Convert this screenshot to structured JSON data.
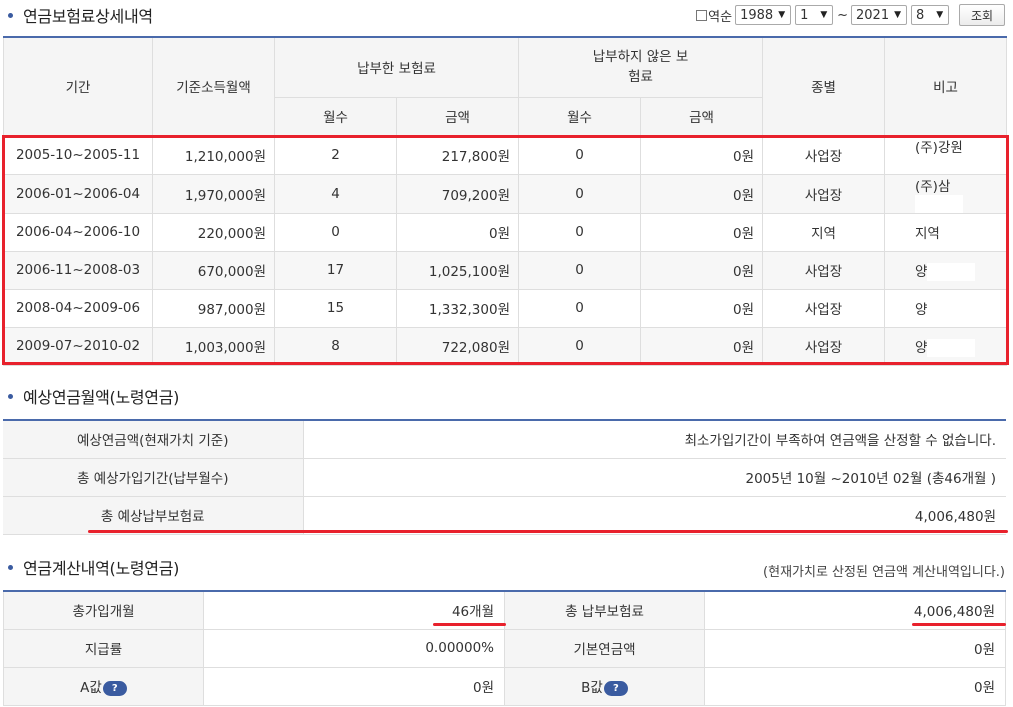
{
  "section1": {
    "title": "연금보험료상세내역",
    "filter": {
      "reverse_label": "역순",
      "start_year": "1988",
      "start_month": "1",
      "tilde": "~",
      "end_year": "2021",
      "end_month": "8",
      "search_label": "조회"
    },
    "headers": {
      "period": "기간",
      "base_income": "기준소득월액",
      "paid": "납부한 보험료",
      "unpaid": "납부하지 않은 보험료",
      "months": "월수",
      "amount": "금액",
      "type": "종별",
      "note": "비고"
    },
    "rows": [
      {
        "period": "2005-10~2005-11",
        "income": "1,210,000원",
        "paid_months": "2",
        "paid_amount": "217,800원",
        "unpaid_months": "0",
        "unpaid_amount": "0원",
        "type": "사업장",
        "note": "(주)강원"
      },
      {
        "period": "2006-01~2006-04",
        "income": "1,970,000원",
        "paid_months": "4",
        "paid_amount": "709,200원",
        "unpaid_months": "0",
        "unpaid_amount": "0원",
        "type": "사업장",
        "note": "(주)삼"
      },
      {
        "period": "2006-04~2006-10",
        "income": "220,000원",
        "paid_months": "0",
        "paid_amount": "0원",
        "unpaid_months": "0",
        "unpaid_amount": "0원",
        "type": "지역",
        "note": "지역"
      },
      {
        "period": "2006-11~2008-03",
        "income": "670,000원",
        "paid_months": "17",
        "paid_amount": "1,025,100원",
        "unpaid_months": "0",
        "unpaid_amount": "0원",
        "type": "사업장",
        "note": "양"
      },
      {
        "period": "2008-04~2009-06",
        "income": "987,000원",
        "paid_months": "15",
        "paid_amount": "1,332,300원",
        "unpaid_months": "0",
        "unpaid_amount": "0원",
        "type": "사업장",
        "note": "양"
      },
      {
        "period": "2009-07~2010-02",
        "income": "1,003,000원",
        "paid_months": "8",
        "paid_amount": "722,080원",
        "unpaid_months": "0",
        "unpaid_amount": "0원",
        "type": "사업장",
        "note": "양"
      }
    ]
  },
  "section2": {
    "title": "예상연금월액(노령연금)",
    "rows": [
      {
        "label": "예상연금액(현재가치 기준)",
        "value": "최소가입기간이 부족하여 연금액을 산정할 수 없습니다."
      },
      {
        "label": "총 예상가입기간(납부월수)",
        "value": "2005년 10월 ~2010년 02월 (총46개월 )"
      },
      {
        "label": "총 예상납부보험료",
        "value": "4,006,480원"
      }
    ]
  },
  "section3": {
    "title": "연금계산내역(노령연금)",
    "note": "(현재가치로 산정된 연금액 계산내역입니다.)",
    "rows": [
      {
        "l1": "총가입개월",
        "v1": "46개월",
        "l2": "총 납부보험료",
        "v2": "4,006,480원"
      },
      {
        "l1": "지급률",
        "v1": "0.00000%",
        "l2": "기본연금액",
        "v2": "0원"
      },
      {
        "l1": "A값",
        "v1": "0원",
        "l2": "B값",
        "v2": "0원"
      }
    ],
    "help_icon": "?"
  },
  "colors": {
    "accent": "#3a5ba0",
    "highlight": "#e8212c"
  }
}
